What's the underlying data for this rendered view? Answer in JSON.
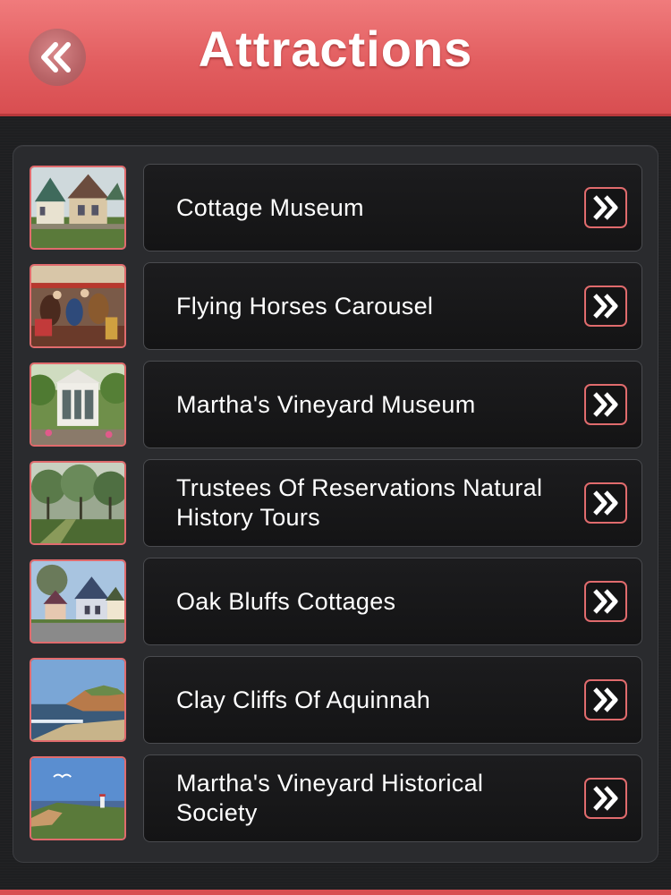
{
  "header": {
    "title": "Attractions",
    "back_icon": "double-chevron-left-icon",
    "colors": {
      "header_bg": "#e25e60",
      "accent": "#e06b6d"
    }
  },
  "attractions": [
    {
      "label": "Cottage Museum",
      "thumb": "cottages-photo",
      "icon": "double-chevron-right-icon"
    },
    {
      "label": "Flying Horses Carousel",
      "thumb": "carousel-photo",
      "icon": "double-chevron-right-icon"
    },
    {
      "label": "Martha's Vineyard Museum",
      "thumb": "museum-gazebo-photo",
      "icon": "double-chevron-right-icon"
    },
    {
      "label": "Trustees Of Reservations Natural History Tours",
      "thumb": "forest-trail-photo",
      "icon": "double-chevron-right-icon"
    },
    {
      "label": "Oak Bluffs Cottages",
      "thumb": "oak-bluffs-houses-photo",
      "icon": "double-chevron-right-icon"
    },
    {
      "label": "Clay Cliffs Of Aquinnah",
      "thumb": "clay-cliffs-photo",
      "icon": "double-chevron-right-icon"
    },
    {
      "label": "Martha's Vineyard Historical Society",
      "thumb": "lighthouse-coast-photo",
      "icon": "double-chevron-right-icon"
    }
  ]
}
